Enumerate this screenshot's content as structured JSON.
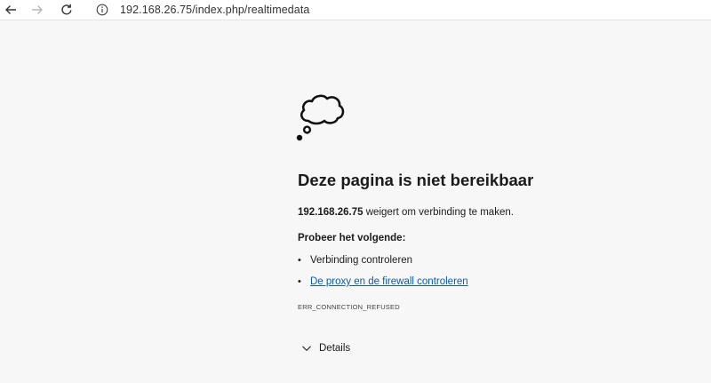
{
  "browser": {
    "url": "192.168.26.75/index.php/realtimedata",
    "icons": {
      "back": "back-arrow-icon",
      "forward": "forward-arrow-icon",
      "reload": "reload-icon",
      "info": "info-icon"
    }
  },
  "error": {
    "icon": "thought-cloud-icon",
    "title": "Deze pagina is niet bereikbaar",
    "host": "192.168.26.75",
    "message_rest": " weigert om verbinding te maken.",
    "try_title": "Probeer het volgende:",
    "suggestions": [
      {
        "text": "Verbinding controleren",
        "link": false
      },
      {
        "text": "De proxy en de firewall controleren",
        "link": true
      }
    ],
    "code": "ERR_CONNECTION_REFUSED",
    "details_label": "Details"
  },
  "colors": {
    "background": "#f7f7f7",
    "link": "#0b5cad",
    "text": "#1b1b1b"
  }
}
